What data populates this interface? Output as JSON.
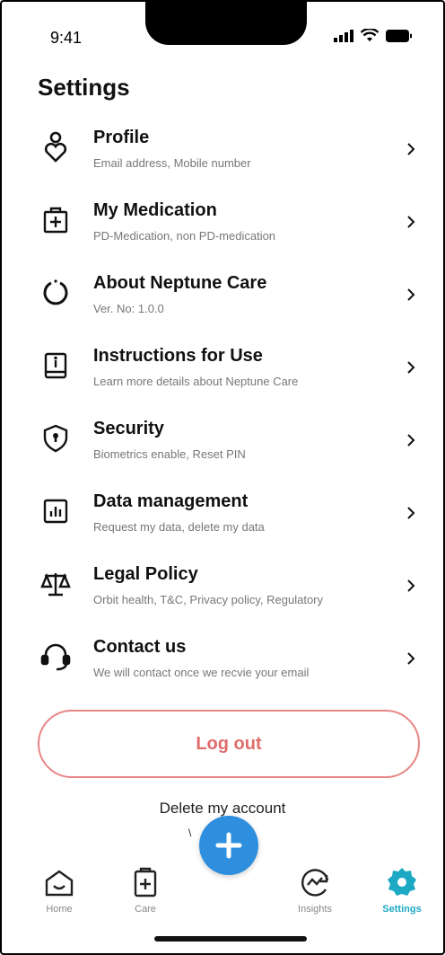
{
  "status_bar": {
    "time": "9:41"
  },
  "page_title": "Settings",
  "settings_items": [
    {
      "label": "Profile",
      "subtitle": "Email address, Mobile number",
      "icon": "profile-heart-icon"
    },
    {
      "label": "My Medication",
      "subtitle": "PD-Medication, non PD-medication",
      "icon": "medication-box-icon"
    },
    {
      "label": "About Neptune Care",
      "subtitle": "Ver. No: 1.0.0",
      "icon": "power-ring-icon"
    },
    {
      "label": "Instructions for Use",
      "subtitle": "Learn more details about Neptune Care",
      "icon": "info-book-icon"
    },
    {
      "label": "Security",
      "subtitle": "Biometrics enable, Reset PIN",
      "icon": "shield-lock-icon"
    },
    {
      "label": "Data management",
      "subtitle": "Request my data, delete my data",
      "icon": "bar-chart-icon"
    },
    {
      "label": "Legal Policy",
      "subtitle": "Orbit health, T&C, Privacy policy, Regulatory",
      "icon": "scales-icon"
    },
    {
      "label": "Contact us",
      "subtitle": "We will contact once we recvie your email",
      "icon": "headset-icon"
    }
  ],
  "logout_label": "Log out",
  "delete_account_label": "Delete my account",
  "version_fragment": "\\          01",
  "tabbar": {
    "home": "Home",
    "care": "Care",
    "insights": "Insights",
    "settings": "Settings",
    "active": "settings"
  },
  "colors": {
    "accent": "#1da9c4",
    "fab": "#2e8fde",
    "logout": "#e06b6b"
  }
}
